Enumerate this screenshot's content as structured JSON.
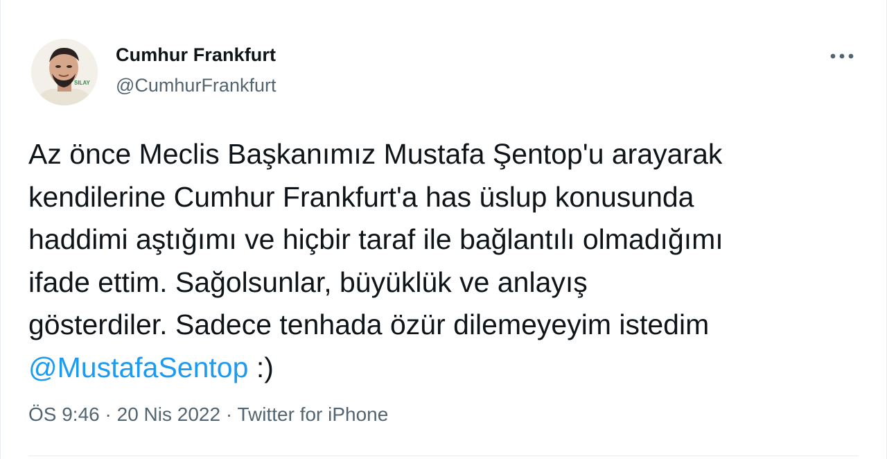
{
  "user": {
    "display_name": "Cumhur Frankfurt",
    "handle": "@CumhurFrankfurt",
    "avatar_badge_text": "SILAY"
  },
  "menu": {
    "icon": "more-horizontal-icon"
  },
  "tweet": {
    "text": "Az önce Meclis Başkanımız Mustafa Şentop'u arayarak\nkendilerine Cumhur Frankfurt'a has üslup konusunda\nhaddimi aştığımı ve hiçbir taraf ile bağlantılı olmadığımı\nifade ettim. Sağolsunlar, büyüklük ve anlayış\ngösterdiler. Sadece tenhada özür dilemeyeyim istedim\n",
    "mention": "@MustafaSentop",
    "suffix": " :)"
  },
  "meta": {
    "time": "ÖS 9:46",
    "separator": " · ",
    "date": "20 Nis 2022",
    "source": "Twitter for iPhone"
  },
  "colors": {
    "link": "#1d9bf0",
    "secondary_text": "#536471",
    "primary_text": "#0f1419"
  }
}
